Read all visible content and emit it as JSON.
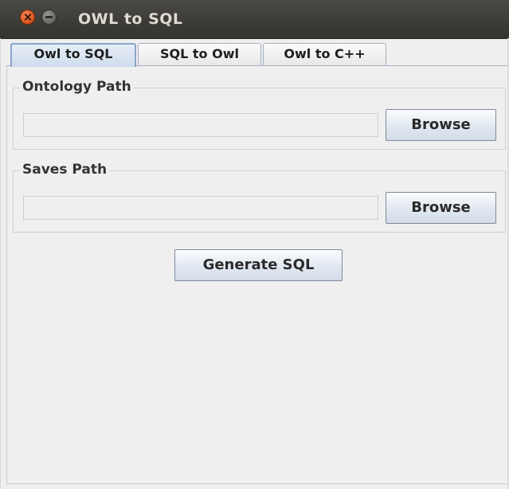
{
  "window": {
    "title": "OWL to SQL"
  },
  "tabs": [
    {
      "label": "Owl to SQL",
      "active": true
    },
    {
      "label": "SQL to Owl",
      "active": false
    },
    {
      "label": "Owl to C++",
      "active": false
    }
  ],
  "ontology": {
    "legend": "Ontology Path",
    "value": "",
    "browse_label": "Browse"
  },
  "saves": {
    "legend": "Saves Path",
    "value": "",
    "browse_label": "Browse"
  },
  "actions": {
    "generate_label": "Generate SQL"
  },
  "colors": {
    "titlebar": "#3c3b37",
    "close_button": "#e05a23",
    "window_bg": "#efefef",
    "active_tab": "#cfdcec"
  },
  "icons": {
    "close": "close-icon",
    "minimize": "minimize-icon"
  }
}
